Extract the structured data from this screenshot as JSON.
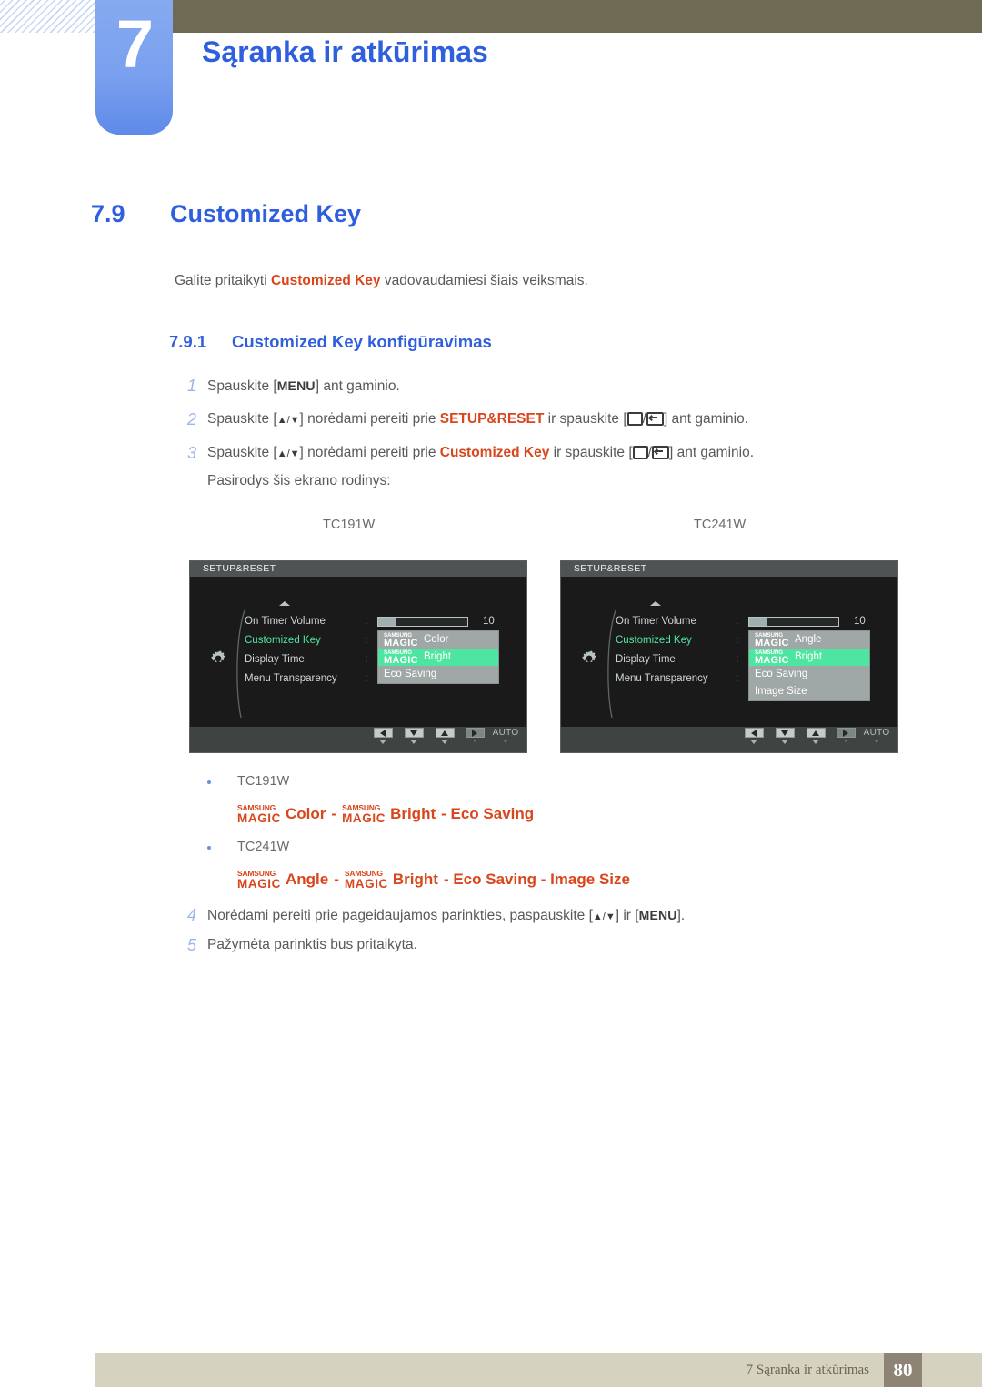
{
  "header": {
    "chapter_number": "7",
    "chapter_title": "Sąranka ir atkūrimas",
    "tab_color": "#7aa0ef",
    "bar_color": "#6e6a54",
    "title_color": "#2f5fdd"
  },
  "section": {
    "number": "7.9",
    "title": "Customized Key",
    "intro_before": "Galite pritaikyti ",
    "intro_highlight": "Customized Key",
    "intro_after": " vadovaudamiesi šiais veiksmais.",
    "highlight_color": "#d9461b"
  },
  "subsection": {
    "number": "7.9.1",
    "title": "Customized Key konfigūravimas"
  },
  "steps": [
    {
      "num": "1",
      "parts": [
        {
          "t": "Spauskite [",
          "k": "text"
        },
        {
          "t": "MENU",
          "k": "keycap"
        },
        {
          "t": "] ant gaminio.",
          "k": "text"
        }
      ]
    },
    {
      "num": "2",
      "parts": [
        {
          "t": "Spauskite [",
          "k": "text"
        },
        {
          "t": "▲/▼",
          "k": "arrows"
        },
        {
          "t": "] norėdami pereiti prie ",
          "k": "text"
        },
        {
          "t": "SETUP&RESET",
          "k": "orange"
        },
        {
          "t": " ir spauskite [",
          "k": "text"
        },
        {
          "t": "back-icon",
          "k": "glyph-back"
        },
        {
          "t": "/",
          "k": "text"
        },
        {
          "t": "enter-icon",
          "k": "glyph-enter"
        },
        {
          "t": "] ant gaminio.",
          "k": "text"
        }
      ]
    },
    {
      "num": "3",
      "parts": [
        {
          "t": "Spauskite [",
          "k": "text"
        },
        {
          "t": "▲/▼",
          "k": "arrows"
        },
        {
          "t": "] norėdami pereiti prie ",
          "k": "text"
        },
        {
          "t": "Customized Key",
          "k": "orange"
        },
        {
          "t": " ir spauskite [",
          "k": "text"
        },
        {
          "t": "back-icon",
          "k": "glyph-back"
        },
        {
          "t": "/",
          "k": "text"
        },
        {
          "t": "enter-icon",
          "k": "glyph-enter"
        },
        {
          "t": "] ant gaminio.",
          "k": "text"
        }
      ]
    }
  ],
  "step3_note": "Pasirodys šis ekrano rodinys:",
  "steps_tail": [
    {
      "num": "4",
      "parts": [
        {
          "t": "Norėdami pereiti prie pageidaujamos parinkties, paspauskite [",
          "k": "text"
        },
        {
          "t": "▲/▼",
          "k": "arrows"
        },
        {
          "t": "] ir [",
          "k": "text"
        },
        {
          "t": "MENU",
          "k": "keycap"
        },
        {
          "t": "].",
          "k": "text"
        }
      ]
    },
    {
      "num": "5",
      "parts": [
        {
          "t": "Pažymėta parinktis bus pritaikyta.",
          "k": "text"
        }
      ]
    }
  ],
  "osd_labels": {
    "left": "TC191W",
    "right": "TC241W"
  },
  "osd": {
    "title": "SETUP&RESET",
    "rows": [
      {
        "label": "On Timer  Volume",
        "active": false,
        "type": "slider",
        "value": "10",
        "fill_percent": 20
      },
      {
        "label": "Customized Key",
        "active": true,
        "type": "plain"
      },
      {
        "label": "Display Time",
        "active": false,
        "type": "plain"
      },
      {
        "label": "Menu Transparency",
        "active": false,
        "type": "plain"
      }
    ],
    "buttons": [
      {
        "name": "left-button",
        "glyph": "tri-left",
        "dim": false,
        "sub": "large"
      },
      {
        "name": "down-button",
        "glyph": "tri-down",
        "dim": false,
        "sub": "large"
      },
      {
        "name": "up-button",
        "glyph": "tri-up",
        "dim": false,
        "sub": "large"
      },
      {
        "name": "right-button",
        "glyph": "tri-right",
        "dim": true,
        "sub": "small"
      },
      {
        "name": "auto-button",
        "label": "AUTO",
        "sub": "small"
      },
      {
        "name": "power-button",
        "label": "⏻",
        "sub": "small"
      }
    ],
    "left_dropdown": [
      {
        "magic": true,
        "magic_top": "SAMSUNG",
        "magic_bot": "MAGIC",
        "text": "Color",
        "selected": false
      },
      {
        "magic": true,
        "magic_top": "SAMSUNG",
        "magic_bot": "MAGIC",
        "text": "Bright",
        "selected": true
      },
      {
        "magic": false,
        "text": "Eco Saving",
        "selected": false
      }
    ],
    "right_dropdown": [
      {
        "magic": true,
        "magic_top": "SAMSUNG",
        "magic_bot": "MAGIC",
        "text": "Angle",
        "selected": false
      },
      {
        "magic": true,
        "magic_top": "SAMSUNG",
        "magic_bot": "MAGIC",
        "text": "Bright",
        "selected": true
      },
      {
        "magic": false,
        "text": "Eco Saving",
        "selected": false
      },
      {
        "magic": false,
        "text": "Image Size",
        "selected": false
      }
    ]
  },
  "bullets": [
    {
      "label": "TC191W",
      "options": [
        {
          "magic": true,
          "magic_top": "SAMSUNG",
          "magic_bot": "MAGIC",
          "text": "Color"
        },
        {
          "magic": false,
          "text": "-"
        },
        {
          "magic": true,
          "magic_top": "SAMSUNG",
          "magic_bot": "MAGIC",
          "text": "Bright"
        },
        {
          "magic": false,
          "text": "- Eco Saving"
        }
      ]
    },
    {
      "label": "TC241W",
      "options": [
        {
          "magic": true,
          "magic_top": "SAMSUNG",
          "magic_bot": "MAGIC",
          "text": "Angle"
        },
        {
          "magic": false,
          "text": "-"
        },
        {
          "magic": true,
          "magic_top": "SAMSUNG",
          "magic_bot": "MAGIC",
          "text": "Bright"
        },
        {
          "magic": false,
          "text": "- Eco Saving - Image Size"
        }
      ]
    }
  ],
  "footer": {
    "text": "7 Sąranka ir atkūrimas",
    "page": "80",
    "bar_color": "#d6d2c0",
    "page_box_color": "#8d8475"
  }
}
